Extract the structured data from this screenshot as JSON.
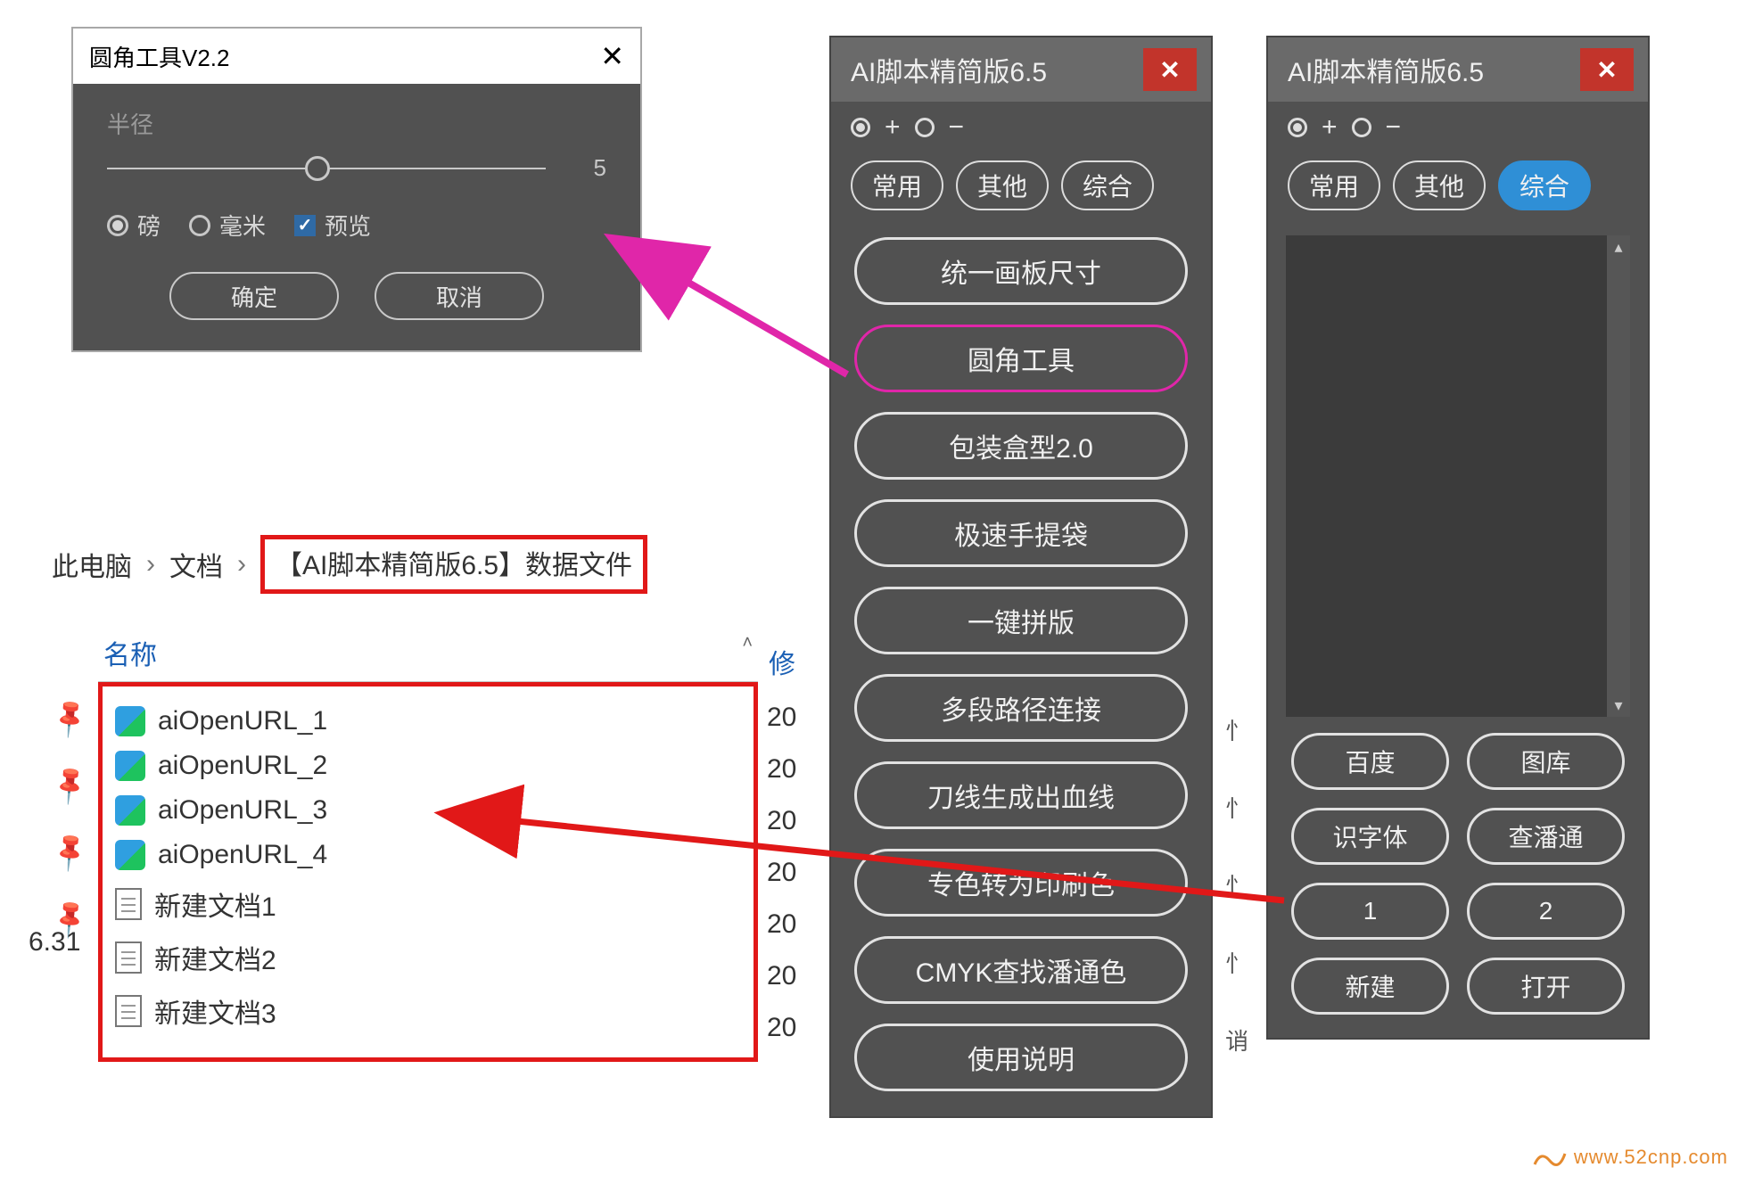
{
  "dialog": {
    "title": "圆角工具V2.2",
    "radius_label": "半径",
    "radius_value": "5",
    "unit_pound": "磅",
    "unit_mm": "毫米",
    "preview": "预览",
    "ok": "确定",
    "cancel": "取消"
  },
  "breadcrumb": {
    "root": "此电脑",
    "docs": "文档",
    "folder": "【AI脚本精简版6.5】数据文件"
  },
  "files": {
    "col_name": "名称",
    "col_date": "修",
    "items": [
      {
        "name": "aiOpenURL_1",
        "date": "20",
        "type": "url"
      },
      {
        "name": "aiOpenURL_2",
        "date": "20",
        "type": "url"
      },
      {
        "name": "aiOpenURL_3",
        "date": "20",
        "type": "url"
      },
      {
        "name": "aiOpenURL_4",
        "date": "20",
        "type": "url"
      },
      {
        "name": "新建文档1",
        "date": "20",
        "type": "doc"
      },
      {
        "name": "新建文档2",
        "date": "20",
        "type": "doc"
      },
      {
        "name": "新建文档3",
        "date": "20",
        "type": "doc"
      }
    ],
    "version_label": "6.31"
  },
  "panel1": {
    "title": "AI脚本精简版6.5",
    "plus": "+",
    "minus": "−",
    "tabs": {
      "common": "常用",
      "other": "其他",
      "mixed": "综合"
    },
    "buttons": [
      "统一画板尺寸",
      "圆角工具",
      "包装盒型2.0",
      "极速手提袋",
      "一键拼版",
      "多段路径连接",
      "刀线生成出血线",
      "专色转为印刷色",
      "CMYK查找潘通色",
      "使用说明"
    ]
  },
  "panel2": {
    "title": "AI脚本精简版6.5",
    "plus": "+",
    "minus": "−",
    "tabs": {
      "common": "常用",
      "other": "其他",
      "mixed": "综合"
    },
    "grid": [
      "百度",
      "图库",
      "识字体",
      "查潘通",
      "1",
      "2",
      "新建",
      "打开"
    ]
  },
  "stray": [
    "忄",
    "忄",
    "忄",
    "忄",
    "诮"
  ],
  "watermark": "www.52cnp.com"
}
